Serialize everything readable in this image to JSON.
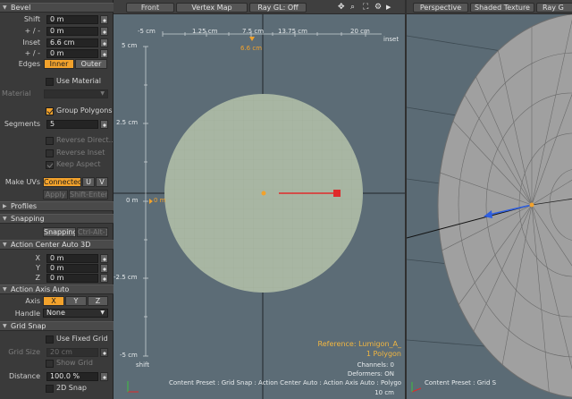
{
  "panel": {
    "bevel": {
      "title": "Bevel",
      "shift_label": "Shift",
      "shift_value": "0 m",
      "shift_pm_label": "+ / -",
      "shift_pm_value": "0 m",
      "inset_label": "Inset",
      "inset_value": "6.6 cm",
      "inset_pm_label": "+ / -",
      "inset_pm_value": "0 m",
      "edges_label": "Edges",
      "edges_inner": "Inner",
      "edges_outer": "Outer",
      "use_material": "Use Material",
      "material_label": "Material",
      "group_polygons": "Group Polygons",
      "segments_label": "Segments",
      "segments_value": "5",
      "reverse_direction": "Reverse Direct...",
      "reverse_inset": "Reverse Inset",
      "keep_aspect": "Keep Aspect",
      "make_uvs_label": "Make UVs",
      "make_uvs_connected": "Connected",
      "make_uvs_u": "U",
      "make_uvs_v": "V",
      "apply": "Apply",
      "shift_enter": "Shift-Enter"
    },
    "profiles": {
      "title": "Profiles"
    },
    "snapping": {
      "title": "Snapping",
      "button": "Snapping",
      "shortcut": "Ctrl-Alt-]"
    },
    "action_center": {
      "title": "Action Center Auto 3D",
      "x_label": "X",
      "x_value": "0 m",
      "y_label": "Y",
      "y_value": "0 m",
      "z_label": "Z",
      "z_value": "0 m"
    },
    "action_axis": {
      "title": "Action Axis Auto",
      "axis_label": "Axis",
      "x": "X",
      "y": "Y",
      "z": "Z",
      "handle_label": "Handle",
      "handle_value": "None"
    },
    "grid_snap": {
      "title": "Grid Snap",
      "use_fixed_grid": "Use Fixed Grid",
      "grid_size_label": "Grid Size",
      "grid_size_value": "20 cm",
      "show_grid": "Show Grid",
      "distance_label": "Distance",
      "distance_value": "100.0 %",
      "snap_2d": "2D Snap"
    }
  },
  "viewport_front": {
    "tabs": {
      "front": "Front",
      "vertex_map": "Vertex Map",
      "ray_gl": "Ray GL: Off"
    },
    "ruler": {
      "ticks": [
        "-5 cm",
        "1.25 cm",
        "7.5 cm",
        "13.75 cm",
        "20 cm"
      ],
      "unit": "inset",
      "value": "6.6 cm"
    },
    "vruler": {
      "ticks": [
        "5 cm",
        "2.5 cm",
        "0 m",
        "-2.5 cm",
        "-5 cm"
      ],
      "unit": "shift",
      "value": "0 m"
    },
    "info": {
      "reference": "Reference: Lumigon_A_",
      "polygons": "1 Polygon",
      "channels": "Channels: 0",
      "deformers": "Deformers: ON",
      "status": "Content Preset : Grid Snap : Action Center Auto : Action Axis Auto : Polygo",
      "grid": "10 cm"
    }
  },
  "viewport_persp": {
    "tabs": {
      "perspective": "Perspective",
      "shaded": "Shaded Texture",
      "ray": "Ray G"
    },
    "status": "Content Preset : Grid S"
  },
  "colors": {
    "accent": "#f2a22c",
    "viewport": "#5c6c76",
    "disc": "#a8b6a3",
    "handle_red": "#e02a2a",
    "handle_blue": "#2f5fe0"
  }
}
